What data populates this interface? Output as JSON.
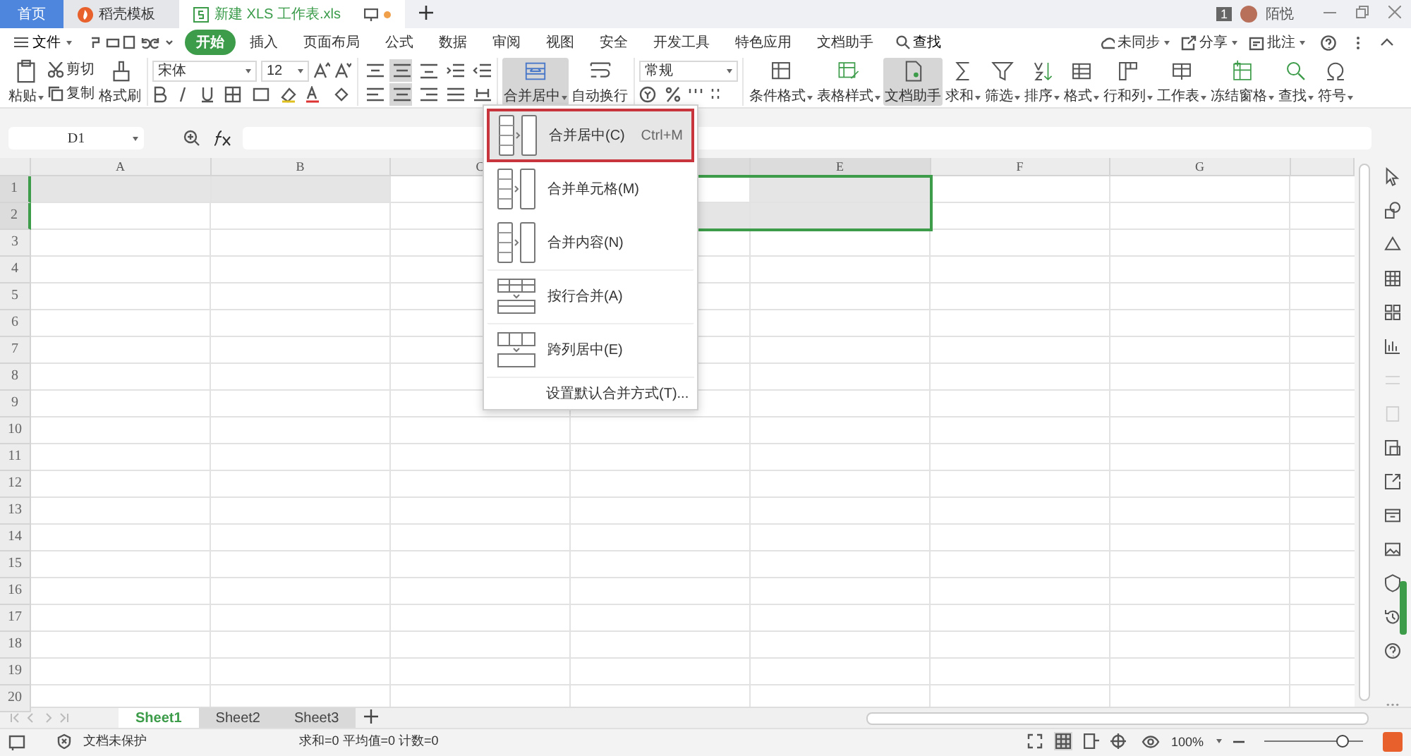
{
  "tabs": [
    {
      "label": "首页",
      "selected": false,
      "kind": "home"
    },
    {
      "label": "稻壳模板",
      "selected": false,
      "kind": "docer"
    },
    {
      "label": "新建 XLS 工作表.xls",
      "selected": true,
      "kind": "sheet"
    }
  ],
  "user": {
    "badge": "1",
    "name": "陌悦"
  },
  "menu": {
    "file": "文件",
    "items": [
      {
        "label": "开始",
        "selected": true
      },
      {
        "label": "插入",
        "selected": false
      },
      {
        "label": "页面布局",
        "selected": false
      },
      {
        "label": "公式",
        "selected": false
      },
      {
        "label": "数据",
        "selected": false
      },
      {
        "label": "审阅",
        "selected": false
      },
      {
        "label": "视图",
        "selected": false
      },
      {
        "label": "安全",
        "selected": false
      },
      {
        "label": "开发工具",
        "selected": false
      },
      {
        "label": "特色应用",
        "selected": false
      },
      {
        "label": "文档助手",
        "selected": false
      }
    ],
    "search": "查找"
  },
  "actions": [
    {
      "label": "未同步",
      "kind": "cloud"
    },
    {
      "label": "分享",
      "kind": "share"
    },
    {
      "label": "批注",
      "kind": "comment"
    }
  ],
  "ribbon": {
    "clipboard": {
      "paste": "粘贴",
      "cut": "剪切",
      "copy": "复制",
      "format_painter": "格式刷"
    },
    "font": {
      "name": "宋体",
      "size": "12"
    },
    "align_top": [
      {
        "kind": "top",
        "selected": false
      },
      {
        "kind": "middle",
        "selected": true
      },
      {
        "kind": "bottom",
        "selected": false
      },
      {
        "kind": "outdent",
        "selected": false
      },
      {
        "kind": "indent",
        "selected": false
      }
    ],
    "align_bottom": [
      {
        "kind": "left",
        "selected": false
      },
      {
        "kind": "center",
        "selected": true
      },
      {
        "kind": "right",
        "selected": false
      },
      {
        "kind": "justify",
        "selected": false
      },
      {
        "kind": "distribute",
        "selected": false
      }
    ],
    "merge": {
      "label": "合并居中",
      "pressed": true
    },
    "wrap": {
      "label": "自动换行",
      "pressed": false
    },
    "number_format": "常规",
    "tools": [
      {
        "label": "条件格式",
        "kind": "condition",
        "pressed": false
      },
      {
        "label": "表格样式",
        "kind": "tablestyle",
        "pressed": false
      },
      {
        "label": "文档助手",
        "kind": "assistant",
        "pressed": true
      },
      {
        "label": "求和",
        "kind": "sum",
        "pressed": false
      },
      {
        "label": "筛选",
        "kind": "filter",
        "pressed": false
      },
      {
        "label": "排序",
        "kind": "sort",
        "pressed": false
      },
      {
        "label": "格式",
        "kind": "format",
        "pressed": false
      },
      {
        "label": "行和列",
        "kind": "rowcol",
        "pressed": false
      },
      {
        "label": "工作表",
        "kind": "worksheet",
        "pressed": false
      },
      {
        "label": "冻结窗格",
        "kind": "freeze",
        "pressed": false
      },
      {
        "label": "查找",
        "kind": "find",
        "pressed": false
      },
      {
        "label": "符号",
        "kind": "symbol",
        "pressed": false
      }
    ]
  },
  "formula_bar": {
    "name_box": "D1"
  },
  "grid": {
    "columns": [
      {
        "label": "A",
        "selected": false
      },
      {
        "label": "B",
        "selected": false
      },
      {
        "label": "C",
        "selected": false
      },
      {
        "selected": true
      },
      {
        "label": "E",
        "selected": true
      },
      {
        "label": "F",
        "selected": false
      },
      {
        "label": "G",
        "selected": false
      }
    ],
    "rows": [
      {
        "label": "1",
        "selected": true,
        "cells": [
          {
            "shaded": true
          },
          {
            "shaded": true
          },
          {
            "shaded": false
          },
          {
            "shaded": false
          },
          {
            "shaded": true
          }
        ]
      },
      {
        "label": "2",
        "selected": true,
        "cells": [
          {
            "shaded": false
          },
          {
            "shaded": false
          },
          {
            "shaded": false
          },
          {
            "shaded": true
          },
          {
            "shaded": true
          }
        ]
      },
      {
        "label": "3",
        "selected": false
      },
      {
        "label": "4",
        "selected": false
      },
      {
        "label": "5",
        "selected": false
      },
      {
        "label": "6",
        "selected": false
      },
      {
        "label": "7",
        "selected": false
      },
      {
        "label": "8",
        "selected": false
      },
      {
        "label": "9",
        "selected": false
      },
      {
        "label": "10",
        "selected": false
      },
      {
        "label": "11",
        "selected": false
      },
      {
        "label": "12",
        "selected": false
      },
      {
        "label": "13",
        "selected": false
      },
      {
        "label": "14",
        "selected": false
      },
      {
        "label": "15",
        "selected": false
      },
      {
        "label": "16",
        "selected": false
      },
      {
        "label": "17",
        "selected": false
      },
      {
        "label": "18",
        "selected": false
      },
      {
        "label": "19",
        "selected": false
      },
      {
        "label": "20",
        "selected": false
      }
    ]
  },
  "merge_menu": {
    "items": [
      {
        "label": "合并居中(C)",
        "shortcut": "Ctrl+M",
        "selected": true,
        "kind": "center"
      },
      {
        "label": "合并单元格(M)",
        "selected": false,
        "kind": "cells"
      },
      {
        "label": "合并内容(N)",
        "selected": false,
        "kind": "content"
      },
      {
        "label": "按行合并(A)",
        "selected": false,
        "kind": "rows"
      },
      {
        "label": "跨列居中(E)",
        "selected": false,
        "kind": "across"
      }
    ],
    "footer": "设置默认合并方式(T)..."
  },
  "sheets": [
    {
      "label": "Sheet1",
      "selected": true
    },
    {
      "label": "Sheet2",
      "selected": false
    },
    {
      "label": "Sheet3",
      "selected": false
    }
  ],
  "status_bar": {
    "protection": "文档未保护",
    "stats": "求和=0 平均值=0 计数=0",
    "zoom": "100%",
    "zoom_slider": {
      "level": 0.78
    }
  }
}
